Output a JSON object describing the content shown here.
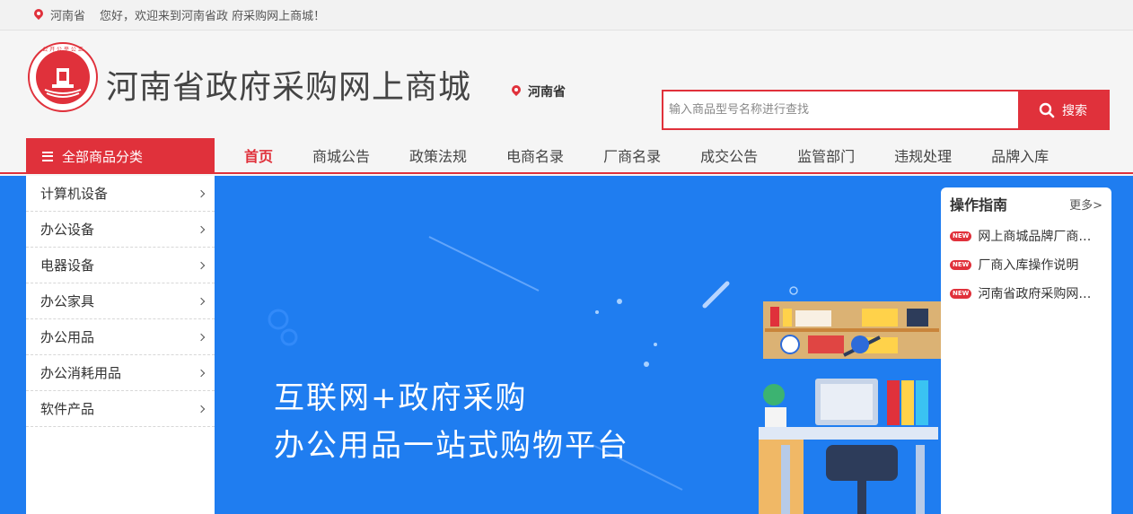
{
  "topbar": {
    "location": "河南省",
    "welcome": "您好，欢迎来到河南省政 府采购网上商城！"
  },
  "header": {
    "logo_text": "HENAN GOVERNMENT PROCUREMENT",
    "site_title": "河南省政府采购网上商城",
    "location": "河南省"
  },
  "search": {
    "placeholder": "输入商品型号名称进行查找",
    "button_label": "搜索"
  },
  "nav": {
    "category_button": "全部商品分类",
    "items": [
      {
        "label": "首页"
      },
      {
        "label": "商城公告"
      },
      {
        "label": "政策法规"
      },
      {
        "label": "电商名录"
      },
      {
        "label": "厂商名录"
      },
      {
        "label": "成交公告"
      },
      {
        "label": "监管部门"
      },
      {
        "label": "违规处理"
      },
      {
        "label": "品牌入库"
      }
    ]
  },
  "categories": [
    {
      "label": "计算机设备"
    },
    {
      "label": "办公设备"
    },
    {
      "label": "电器设备"
    },
    {
      "label": "办公家具"
    },
    {
      "label": "办公用品"
    },
    {
      "label": "办公消耗用品"
    },
    {
      "label": "软件产品"
    }
  ],
  "banner": {
    "line1": "互联网+政府采购",
    "line2": "办公用品一站式购物平台"
  },
  "guide": {
    "title": "操作指南",
    "more": "更多>",
    "badge": "NEW",
    "items": [
      {
        "label": "网上商城品牌厂商入库说明"
      },
      {
        "label": "厂商入库操作说明"
      },
      {
        "label": "河南省政府采购网上商城操作手册"
      }
    ]
  },
  "colors": {
    "accent": "#e0313b",
    "banner_bg": "#1f7df0"
  }
}
